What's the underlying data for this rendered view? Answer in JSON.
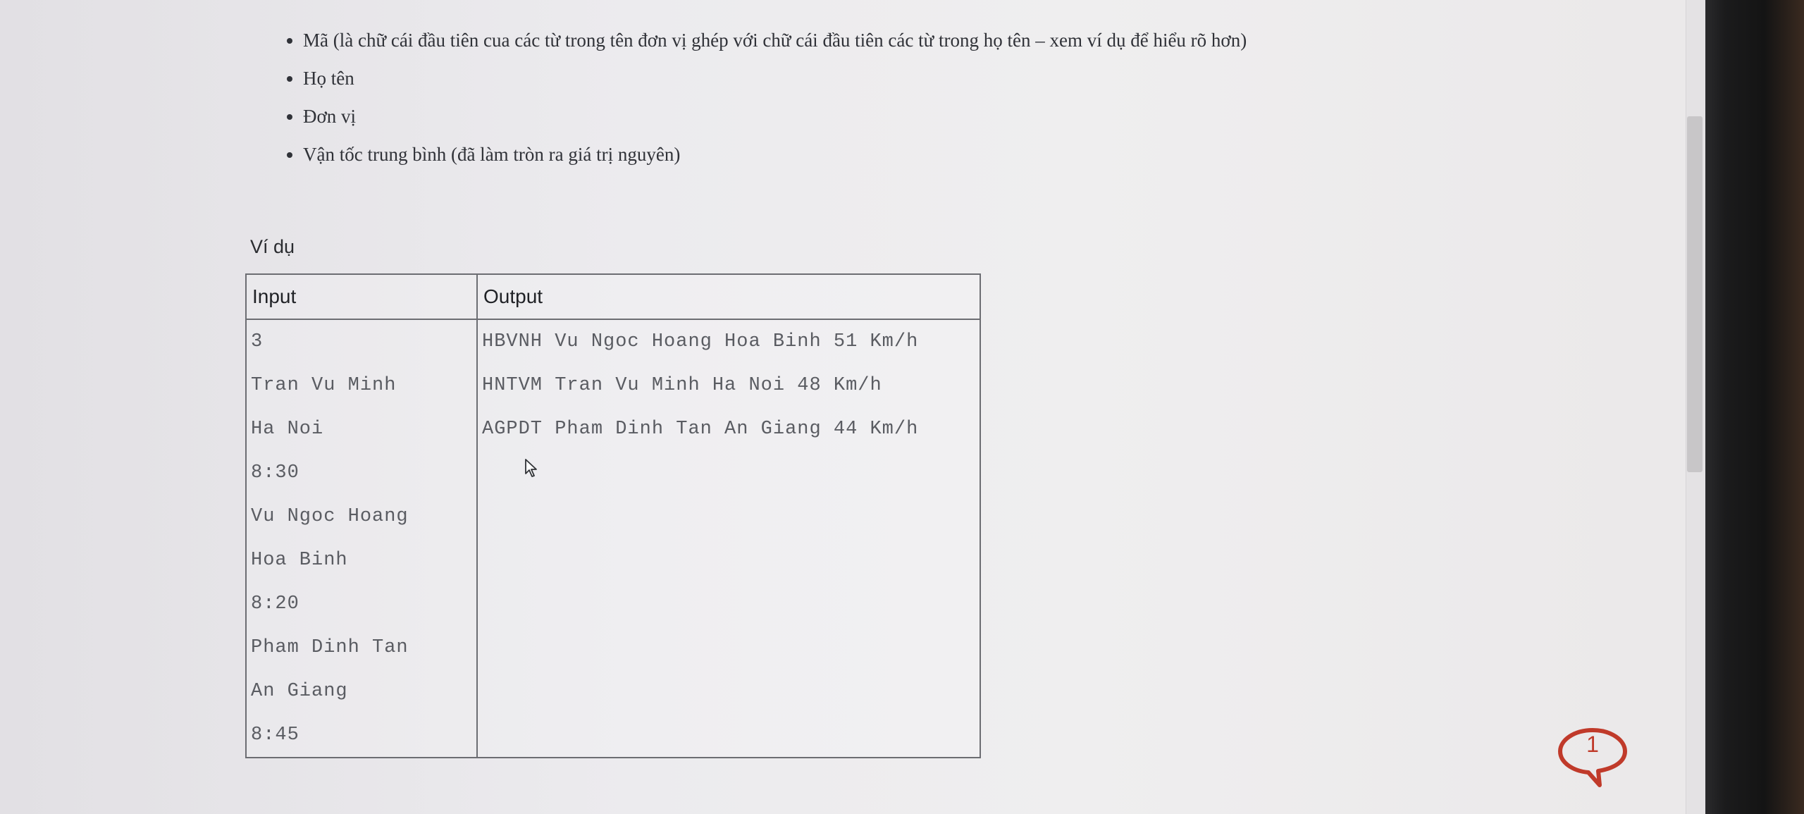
{
  "bullets": [
    "Mã (là chữ cái đầu tiên cua các từ trong tên đơn vị ghép với chữ cái đầu tiên các từ trong họ tên – xem ví dụ để hiểu rõ hơn)",
    "Họ tên",
    "Đơn vị",
    "Vận tốc trung bình (đã làm tròn ra giá trị nguyên)"
  ],
  "example": {
    "title": "Ví dụ",
    "headers": {
      "input": "Input",
      "output": "Output"
    },
    "input_lines": [
      "3",
      "Tran Vu Minh",
      "Ha Noi",
      "8:30",
      "Vu Ngoc Hoang",
      "Hoa Binh",
      "8:20",
      "Pham Dinh Tan",
      "An Giang",
      "8:45"
    ],
    "output_lines": [
      "HBVNH Vu Ngoc Hoang Hoa Binh 51 Km/h",
      "HNTVM Tran Vu Minh Ha Noi 48 Km/h",
      "AGPDT Pham Dinh Tan An Giang 44 Km/h"
    ]
  },
  "comment_badge": {
    "count": "1",
    "color": "#c03a2a"
  },
  "icons": [
    "mouse-cursor-icon",
    "comment-bubble-icon"
  ]
}
